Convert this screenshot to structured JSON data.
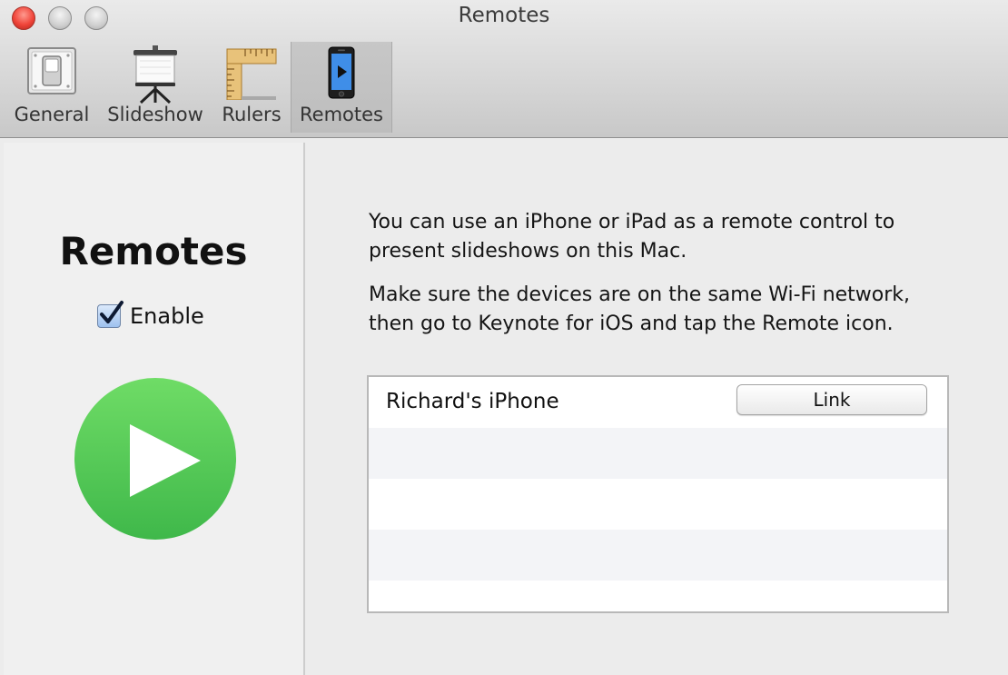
{
  "window": {
    "title": "Remotes"
  },
  "toolbar": {
    "items": [
      {
        "label": "General"
      },
      {
        "label": "Slideshow"
      },
      {
        "label": "Rulers"
      },
      {
        "label": "Remotes"
      }
    ],
    "selected": "Remotes"
  },
  "left": {
    "heading": "Remotes",
    "enable_label": "Enable",
    "enable_checked": true
  },
  "right": {
    "description_1": "You can use an iPhone or iPad as a remote control to present slideshows on this Mac.",
    "description_2": "Make sure the devices are on the same Wi-Fi network, then go to Keynote for iOS and tap the Remote icon.",
    "devices": [
      {
        "name": "Richard's iPhone",
        "action_label": "Link"
      }
    ]
  },
  "colors": {
    "play_green": "#5ccf5a",
    "close_red": "#f0453a",
    "checkbox_blue": "#9ec1ee"
  }
}
